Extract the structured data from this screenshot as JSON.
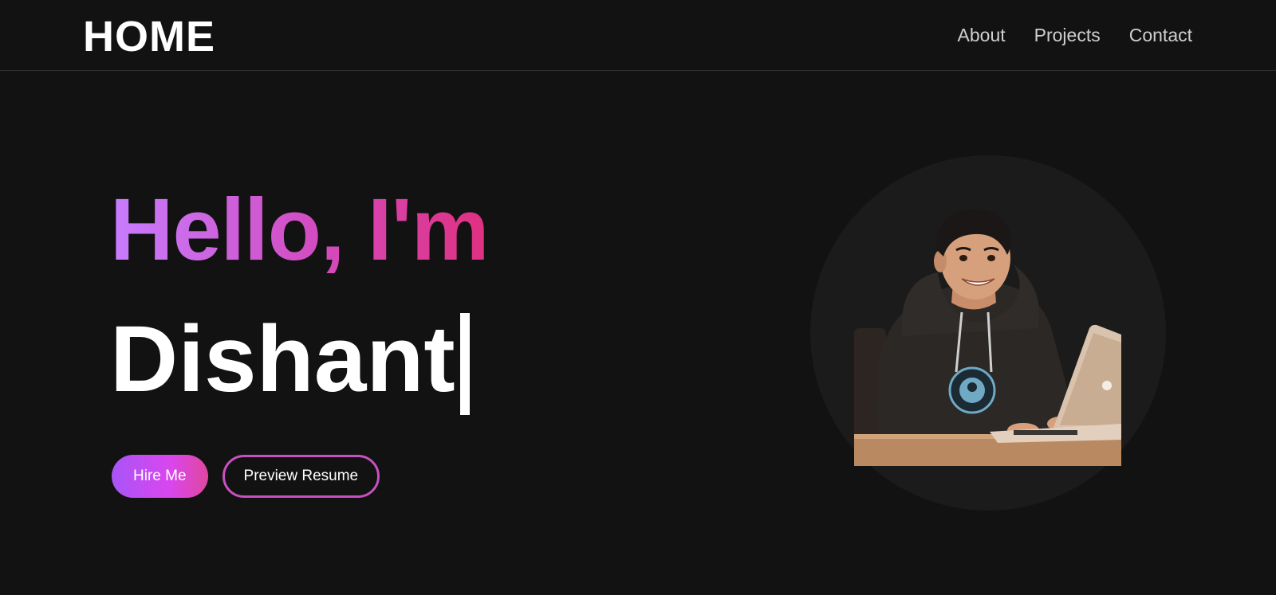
{
  "nav": {
    "logo": "HOME",
    "links": [
      {
        "label": "About"
      },
      {
        "label": "Projects"
      },
      {
        "label": "Contact"
      }
    ]
  },
  "hero": {
    "greeting": "Hello, I'm",
    "name": "Dishant",
    "buttons": {
      "primary": "Hire Me",
      "secondary": "Preview Resume"
    }
  },
  "colors": {
    "background": "#121212",
    "gradient_start": "#c77dff",
    "gradient_end": "#e0307f",
    "text": "#ffffff",
    "nav_text": "#cfcfcf"
  },
  "icons": {
    "avatar": "cartoon-developer-avatar"
  }
}
